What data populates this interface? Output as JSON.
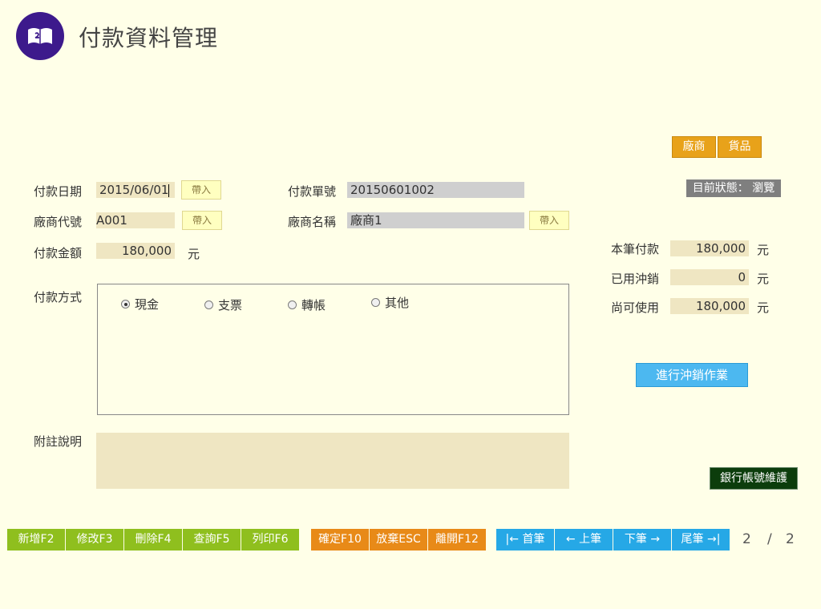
{
  "header": {
    "title": "付款資料管理"
  },
  "top_buttons": {
    "vendor": "廠商",
    "goods": "貨品"
  },
  "status": {
    "label": "目前狀態：",
    "value": "瀏覽"
  },
  "form": {
    "pay_date_label": "付款日期",
    "pay_date_value": "2015/06/01",
    "import_label": "帶入",
    "pay_no_label": "付款單號",
    "pay_no_value": "20150601002",
    "vendor_code_label": "廠商代號",
    "vendor_code_value": "A001",
    "vendor_name_label": "廠商名稱",
    "vendor_name_value": "廠商1",
    "amount_label": "付款金額",
    "amount_value": "180,000",
    "unit": "元",
    "method_label": "付款方式",
    "methods": [
      "現金",
      "支票",
      "轉帳",
      "其他"
    ],
    "selected_method": "現金",
    "note_label": "附註說明",
    "note_value": ""
  },
  "summary": {
    "current_label": "本筆付款",
    "current_value": "180,000",
    "used_label": "已用沖銷",
    "used_value": "0",
    "remain_label": "尚可使用",
    "remain_value": "180,000",
    "unit": "元",
    "offset_button": "進行沖銷作業"
  },
  "bank_button": "銀行帳號維護",
  "toolbar": {
    "edit_group": [
      "新增F2",
      "修改F3",
      "刪除F4",
      "查詢F5",
      "列印F6"
    ],
    "confirm_group": [
      "確定F10",
      "放棄ESC",
      "離開F12"
    ],
    "nav_group": [
      "|← 首筆",
      "← 上筆",
      "下筆 →",
      "尾筆 →|"
    ]
  },
  "pager": {
    "current": "2",
    "separator": "/",
    "total": "2"
  },
  "colors": {
    "background": "#ffffe8",
    "accent_orange": "#e8a21a",
    "logo_purple": "#3d1a8c"
  },
  "icons": {
    "logo": "book-icon"
  }
}
